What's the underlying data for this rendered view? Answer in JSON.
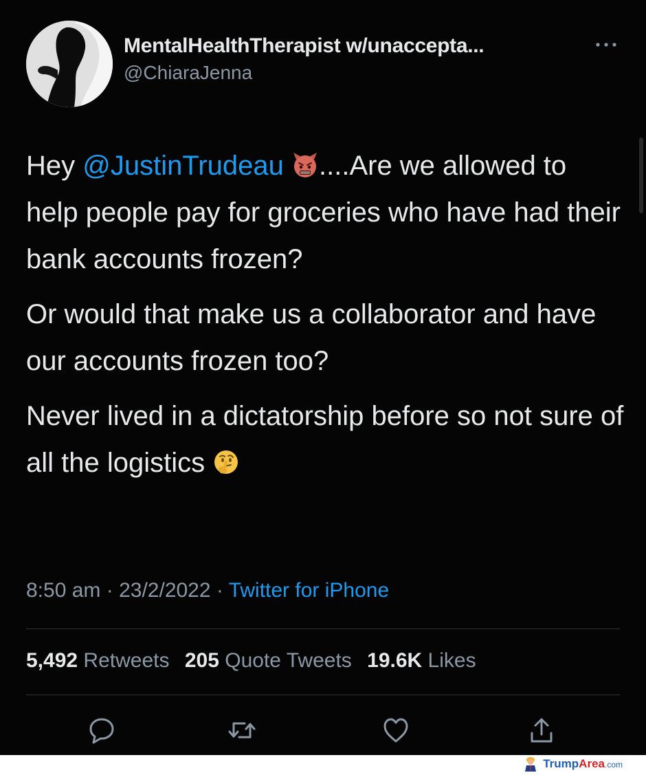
{
  "tweet": {
    "display_name": "MentalHealthTherapist w/unaccepta...",
    "handle": "@ChiaraJenna",
    "body": {
      "p1_prefix": "Hey ",
      "mention": "@JustinTrudeau",
      "p1_suffix": "....Are we allowed to help people pay for groceries who have had their bank accounts frozen?",
      "p2": "Or would that make us a collaborator and have our accounts frozen too?",
      "p3": "Never lived in a dictatorship before so not sure of all the logistics"
    },
    "meta": {
      "time": "8:50 am",
      "date": "23/2/2022",
      "separator": "·",
      "source": "Twitter for iPhone"
    },
    "stats": {
      "retweets_count": "5,492",
      "retweets_label": "Retweets",
      "quotes_count": "205",
      "quotes_label": "Quote Tweets",
      "likes_count": "19.6K",
      "likes_label": "Likes"
    },
    "icons": {
      "more": "more-icon",
      "emoji_1": "devil-emoji",
      "emoji_2": "thinking-face-emoji",
      "reply": "reply-icon",
      "retweet": "retweet-icon",
      "like": "heart-icon",
      "share": "share-icon"
    },
    "colors": {
      "background": "#050505",
      "text": "#e7e9ea",
      "secondary": "#8b98a5",
      "link": "#1d9bf0"
    }
  },
  "watermark": {
    "brand_part1": "Trump",
    "brand_part2": "Area",
    "brand_part3": ".com"
  }
}
